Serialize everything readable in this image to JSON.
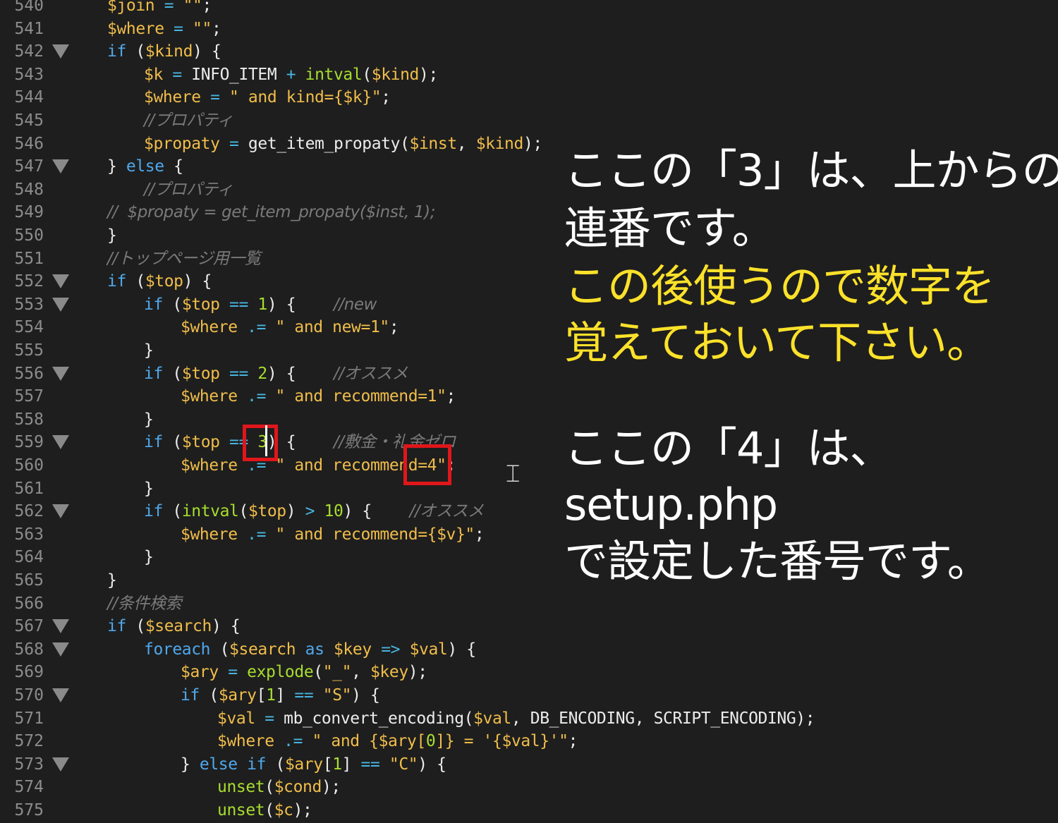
{
  "editor": {
    "lines": [
      {
        "num": "540",
        "fold": false,
        "indent": 0,
        "tokens": [
          [
            "v",
            "$join"
          ],
          [
            "op",
            " = "
          ],
          [
            "s",
            "\"\""
          ],
          [
            "p",
            ";"
          ]
        ]
      },
      {
        "num": "541",
        "fold": false,
        "indent": 0,
        "tokens": [
          [
            "v",
            "$where"
          ],
          [
            "op",
            " = "
          ],
          [
            "s",
            "\"\""
          ],
          [
            "p",
            ";"
          ]
        ]
      },
      {
        "num": "542",
        "fold": true,
        "indent": 0,
        "tokens": [
          [
            "kw",
            "if"
          ],
          [
            "p",
            " ("
          ],
          [
            "v",
            "$kind"
          ],
          [
            "p",
            ") {"
          ]
        ]
      },
      {
        "num": "543",
        "fold": false,
        "indent": 1,
        "tokens": [
          [
            "v",
            "$k"
          ],
          [
            "op",
            " = "
          ],
          [
            "p",
            "INFO_ITEM"
          ],
          [
            "op",
            " + "
          ],
          [
            "fn",
            "intval"
          ],
          [
            "p",
            "("
          ],
          [
            "v",
            "$kind"
          ],
          [
            "p",
            ");"
          ]
        ]
      },
      {
        "num": "544",
        "fold": false,
        "indent": 1,
        "tokens": [
          [
            "v",
            "$where"
          ],
          [
            "op",
            " = "
          ],
          [
            "s",
            "\" and kind={$k}\""
          ],
          [
            "p",
            ";"
          ]
        ]
      },
      {
        "num": "545",
        "fold": false,
        "indent": 1,
        "tokens": [
          [
            "c",
            "//プロパティ"
          ]
        ]
      },
      {
        "num": "546",
        "fold": false,
        "indent": 1,
        "tokens": [
          [
            "v",
            "$propaty"
          ],
          [
            "op",
            " = "
          ],
          [
            "p",
            "get_item_propaty("
          ],
          [
            "v",
            "$inst"
          ],
          [
            "p",
            ", "
          ],
          [
            "v",
            "$kind"
          ],
          [
            "p",
            ");"
          ]
        ]
      },
      {
        "num": "547",
        "fold": true,
        "indent": 0,
        "tokens": [
          [
            "p",
            "} "
          ],
          [
            "kw",
            "else"
          ],
          [
            "p",
            " {"
          ]
        ]
      },
      {
        "num": "548",
        "fold": false,
        "indent": 1,
        "tokens": [
          [
            "c",
            "//プロパティ"
          ]
        ]
      },
      {
        "num": "549",
        "fold": false,
        "indent": 0,
        "tokens": [
          [
            "c",
            "//  $propaty = get_item_propaty($inst, 1);"
          ]
        ]
      },
      {
        "num": "550",
        "fold": false,
        "indent": 0,
        "tokens": [
          [
            "p",
            "}"
          ]
        ]
      },
      {
        "num": "551",
        "fold": false,
        "indent": 0,
        "tokens": [
          [
            "c",
            "//トップページ用一覧"
          ]
        ]
      },
      {
        "num": "552",
        "fold": true,
        "indent": 0,
        "tokens": [
          [
            "kw",
            "if"
          ],
          [
            "p",
            " ("
          ],
          [
            "v",
            "$top"
          ],
          [
            "p",
            ") {"
          ]
        ]
      },
      {
        "num": "553",
        "fold": true,
        "indent": 1,
        "tokens": [
          [
            "kw",
            "if"
          ],
          [
            "p",
            " ("
          ],
          [
            "v",
            "$top"
          ],
          [
            "op",
            " == "
          ],
          [
            "n",
            "1"
          ],
          [
            "p",
            ") {    "
          ],
          [
            "c",
            "//new"
          ]
        ]
      },
      {
        "num": "554",
        "fold": false,
        "indent": 2,
        "tokens": [
          [
            "v",
            "$where"
          ],
          [
            "op",
            " .= "
          ],
          [
            "s",
            "\" and new=1\""
          ],
          [
            "p",
            ";"
          ]
        ]
      },
      {
        "num": "555",
        "fold": false,
        "indent": 1,
        "tokens": [
          [
            "p",
            "}"
          ]
        ]
      },
      {
        "num": "556",
        "fold": true,
        "indent": 1,
        "tokens": [
          [
            "kw",
            "if"
          ],
          [
            "p",
            " ("
          ],
          [
            "v",
            "$top"
          ],
          [
            "op",
            " == "
          ],
          [
            "n",
            "2"
          ],
          [
            "p",
            ") {    "
          ],
          [
            "c",
            "//オススメ"
          ]
        ]
      },
      {
        "num": "557",
        "fold": false,
        "indent": 2,
        "tokens": [
          [
            "v",
            "$where"
          ],
          [
            "op",
            " .= "
          ],
          [
            "s",
            "\" and recommend=1\""
          ],
          [
            "p",
            ";"
          ]
        ]
      },
      {
        "num": "558",
        "fold": false,
        "indent": 1,
        "tokens": [
          [
            "p",
            "}"
          ]
        ]
      },
      {
        "num": "559",
        "fold": true,
        "indent": 1,
        "tokens": [
          [
            "kw",
            "if"
          ],
          [
            "p",
            " ("
          ],
          [
            "v",
            "$top"
          ],
          [
            "op",
            " == "
          ],
          [
            "n",
            "3"
          ],
          [
            "p",
            ") {    "
          ],
          [
            "c",
            "//敷金・礼金ゼロ"
          ]
        ]
      },
      {
        "num": "560",
        "fold": false,
        "indent": 2,
        "tokens": [
          [
            "v",
            "$where"
          ],
          [
            "op",
            " .= "
          ],
          [
            "s",
            "\" and recommend=4\""
          ],
          [
            "p",
            ";"
          ]
        ]
      },
      {
        "num": "561",
        "fold": false,
        "indent": 1,
        "tokens": [
          [
            "p",
            "}"
          ]
        ]
      },
      {
        "num": "562",
        "fold": true,
        "indent": 1,
        "tokens": [
          [
            "kw",
            "if"
          ],
          [
            "p",
            " ("
          ],
          [
            "fn",
            "intval"
          ],
          [
            "p",
            "("
          ],
          [
            "v",
            "$top"
          ],
          [
            "p",
            ")"
          ],
          [
            "op",
            " > "
          ],
          [
            "n",
            "10"
          ],
          [
            "p",
            ") {    "
          ],
          [
            "c",
            "//オススメ"
          ]
        ]
      },
      {
        "num": "563",
        "fold": false,
        "indent": 2,
        "tokens": [
          [
            "v",
            "$where"
          ],
          [
            "op",
            " .= "
          ],
          [
            "s",
            "\" and recommend={$v}\""
          ],
          [
            "p",
            ";"
          ]
        ]
      },
      {
        "num": "564",
        "fold": false,
        "indent": 1,
        "tokens": [
          [
            "p",
            "}"
          ]
        ]
      },
      {
        "num": "565",
        "fold": false,
        "indent": 0,
        "tokens": [
          [
            "p",
            "}"
          ]
        ]
      },
      {
        "num": "566",
        "fold": false,
        "indent": 0,
        "tokens": [
          [
            "c",
            "//条件検索"
          ]
        ]
      },
      {
        "num": "567",
        "fold": true,
        "indent": 0,
        "tokens": [
          [
            "kw",
            "if"
          ],
          [
            "p",
            " ("
          ],
          [
            "v",
            "$search"
          ],
          [
            "p",
            ") {"
          ]
        ]
      },
      {
        "num": "568",
        "fold": true,
        "indent": 1,
        "tokens": [
          [
            "kw",
            "foreach"
          ],
          [
            "p",
            " ("
          ],
          [
            "v",
            "$search"
          ],
          [
            "kw",
            " as "
          ],
          [
            "v",
            "$key"
          ],
          [
            "op",
            " => "
          ],
          [
            "v",
            "$val"
          ],
          [
            "p",
            ") {"
          ]
        ]
      },
      {
        "num": "569",
        "fold": false,
        "indent": 2,
        "tokens": [
          [
            "v",
            "$ary"
          ],
          [
            "op",
            " = "
          ],
          [
            "fn",
            "explode"
          ],
          [
            "p",
            "("
          ],
          [
            "s",
            "\"_\""
          ],
          [
            "p",
            ", "
          ],
          [
            "v",
            "$key"
          ],
          [
            "p",
            ");"
          ]
        ]
      },
      {
        "num": "570",
        "fold": true,
        "indent": 2,
        "tokens": [
          [
            "kw",
            "if"
          ],
          [
            "p",
            " ("
          ],
          [
            "v",
            "$ary"
          ],
          [
            "p",
            "["
          ],
          [
            "n",
            "1"
          ],
          [
            "p",
            "]"
          ],
          [
            "op",
            " == "
          ],
          [
            "s",
            "\"S\""
          ],
          [
            "p",
            ") {"
          ]
        ]
      },
      {
        "num": "571",
        "fold": false,
        "indent": 3,
        "tokens": [
          [
            "v",
            "$val"
          ],
          [
            "op",
            " = "
          ],
          [
            "p",
            "mb_convert_encoding("
          ],
          [
            "v",
            "$val"
          ],
          [
            "p",
            ", DB_ENCODING, SCRIPT_ENCODING);"
          ]
        ]
      },
      {
        "num": "572",
        "fold": false,
        "indent": 3,
        "tokens": [
          [
            "v",
            "$where"
          ],
          [
            "op",
            " .= "
          ],
          [
            "s",
            "\" and {$ary["
          ],
          [
            "n",
            "0"
          ],
          [
            "s",
            "]} = '{$val}'\""
          ],
          [
            "p",
            ";"
          ]
        ]
      },
      {
        "num": "573",
        "fold": true,
        "indent": 2,
        "tokens": [
          [
            "p",
            "} "
          ],
          [
            "kw",
            "else if"
          ],
          [
            "p",
            " ("
          ],
          [
            "v",
            "$ary"
          ],
          [
            "p",
            "["
          ],
          [
            "n",
            "1"
          ],
          [
            "p",
            "]"
          ],
          [
            "op",
            " == "
          ],
          [
            "s",
            "\"C\""
          ],
          [
            "p",
            ") {"
          ]
        ]
      },
      {
        "num": "574",
        "fold": false,
        "indent": 3,
        "tokens": [
          [
            "fn",
            "unset"
          ],
          [
            "p",
            "("
          ],
          [
            "v",
            "$cond"
          ],
          [
            "p",
            ");"
          ]
        ]
      },
      {
        "num": "575",
        "fold": false,
        "indent": 3,
        "tokens": [
          [
            "fn",
            "unset"
          ],
          [
            "p",
            "("
          ],
          [
            "v",
            "$c"
          ],
          [
            "p",
            ");"
          ]
        ]
      }
    ]
  },
  "annotation": {
    "top_white": [
      "ここの「3」は、上からの",
      "連番です。"
    ],
    "top_yellow": [
      "この後使うので数字を",
      "覚えておいて下さい。"
    ],
    "bottom_white": [
      "ここの「4」は、",
      "setup.php",
      "で設定した番号です。"
    ]
  },
  "colors": {
    "background": "#1e1e1e",
    "highlight_box": "#e0161b",
    "annotation_white": "#ffffff",
    "annotation_yellow": "#fce12a"
  }
}
